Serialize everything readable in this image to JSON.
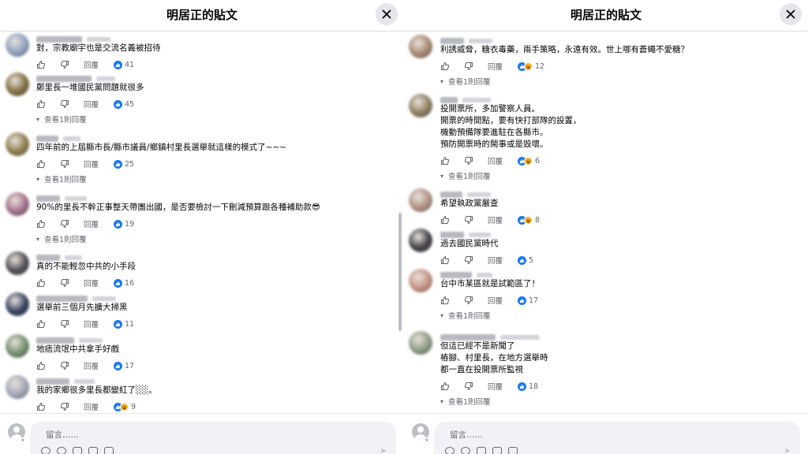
{
  "left": {
    "title": "明居正的貼文",
    "placeholder": "留言……",
    "comments": [
      {
        "text": "對，宗教廟宇也是交流名義被招待",
        "likes": "41",
        "haha": false,
        "view": ""
      },
      {
        "text": "鄭里長一堆國民黨問題就很多",
        "likes": "45",
        "haha": false,
        "view": "查看1則回覆"
      },
      {
        "text": "四年前的上屆縣市長/縣市議員/鄉鎮村里長選舉就這樣的模式了~~~",
        "likes": "25",
        "haha": false,
        "view": "查看1則回覆"
      },
      {
        "text": "90%的里長不幹正事整天帶團出國，是否要檢討一下刪減預算跟各種補助款😎",
        "likes": "19",
        "haha": false,
        "view": "查看1則回覆"
      },
      {
        "text": "真的不能輕忽中共的小手段",
        "likes": "16",
        "haha": false,
        "view": ""
      },
      {
        "text": "選舉前三個月先擴大掃黑",
        "likes": "11",
        "haha": false,
        "view": ""
      },
      {
        "text": "地痞流氓中共拿手好戲",
        "likes": "17",
        "haha": false,
        "view": ""
      },
      {
        "text": "我的家鄉很多里長都變紅了░░。",
        "likes": "9",
        "haha": true,
        "view": ""
      }
    ]
  },
  "right": {
    "title": "明居正的貼文",
    "placeholder": "留言……",
    "comments": [
      {
        "text": "利誘威脅，糖衣毒藥，兩手策略，永遠有效。世上哪有蒼蠅不愛糖？",
        "likes": "12",
        "haha": true,
        "view": "查看1則回覆"
      },
      {
        "text": "投開票所，多加警察人員。\n開票的時間點，要有快打部隊的設置，\n機動預備隊要進駐在各縣市。\n預防開票時的鬧事或是毀壞。",
        "likes": "6",
        "haha": true,
        "view": "查看1則回覆"
      },
      {
        "text": "希望執政黨嚴查",
        "likes": "8",
        "haha": true,
        "view": ""
      },
      {
        "text": "過去國民黨時代",
        "likes": "5",
        "haha": false,
        "view": ""
      },
      {
        "text": "台中市某區就是試範區了！",
        "likes": "17",
        "haha": false,
        "view": "查看1則回覆"
      },
      {
        "text": "但這已經不是新聞了\n樁腳、村里長，在地方選舉時\n都一直在投開票所監視",
        "likes": "18",
        "haha": false,
        "view": "查看1則回覆"
      }
    ]
  },
  "actions": {
    "reply_label": "回覆"
  },
  "colors": {
    "accent": "#1877f2",
    "haha": "#f7b125",
    "secondary_text": "#65676b"
  },
  "icons": {
    "close": "close-icon",
    "like": "thumbs-up-icon",
    "dislike": "thumbs-down-icon",
    "like_reaction": "like-reaction-icon",
    "haha_reaction": "haha-reaction-icon"
  }
}
